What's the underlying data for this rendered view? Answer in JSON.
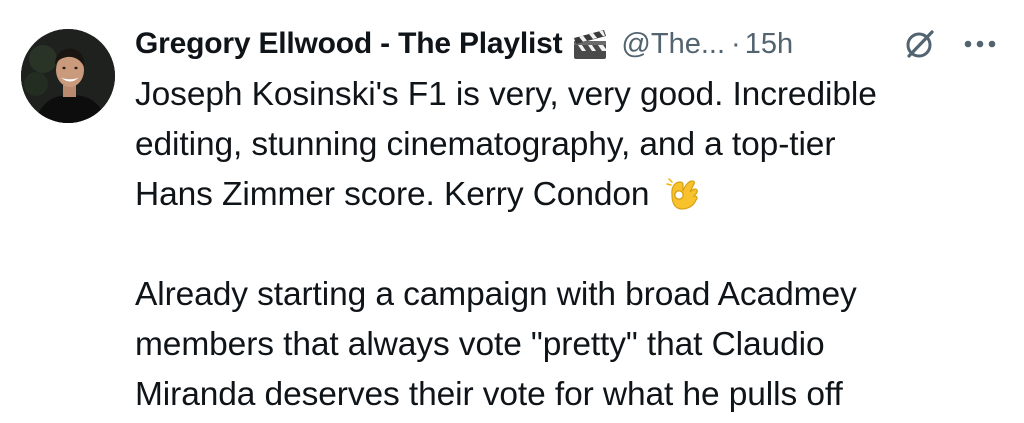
{
  "author": {
    "display_name": "Gregory Ellwood - The Playlist",
    "name_emoji": "clapper-board-icon",
    "handle": "@The...",
    "separator": "·",
    "timestamp": "15h"
  },
  "icons": {
    "grok": "grok-icon",
    "more": "more-options-icon"
  },
  "tweet": {
    "paragraph1": {
      "line1": "Joseph Kosinski's F1 is very, very good. Incredible",
      "line2": "editing, stunning cinematography, and a top-tier",
      "line3": "Hans Zimmer score. Kerry Condon",
      "line3_emoji": "ok-hand-icon"
    },
    "paragraph2": {
      "line1": "Already starting a campaign with broad Acadmey",
      "line2": "members that always vote \"pretty\" that Claudio",
      "line3": "Miranda deserves their vote for what he pulls off"
    }
  },
  "colors": {
    "text_primary": "#0f1419",
    "text_secondary": "#536471",
    "background": "#ffffff"
  }
}
